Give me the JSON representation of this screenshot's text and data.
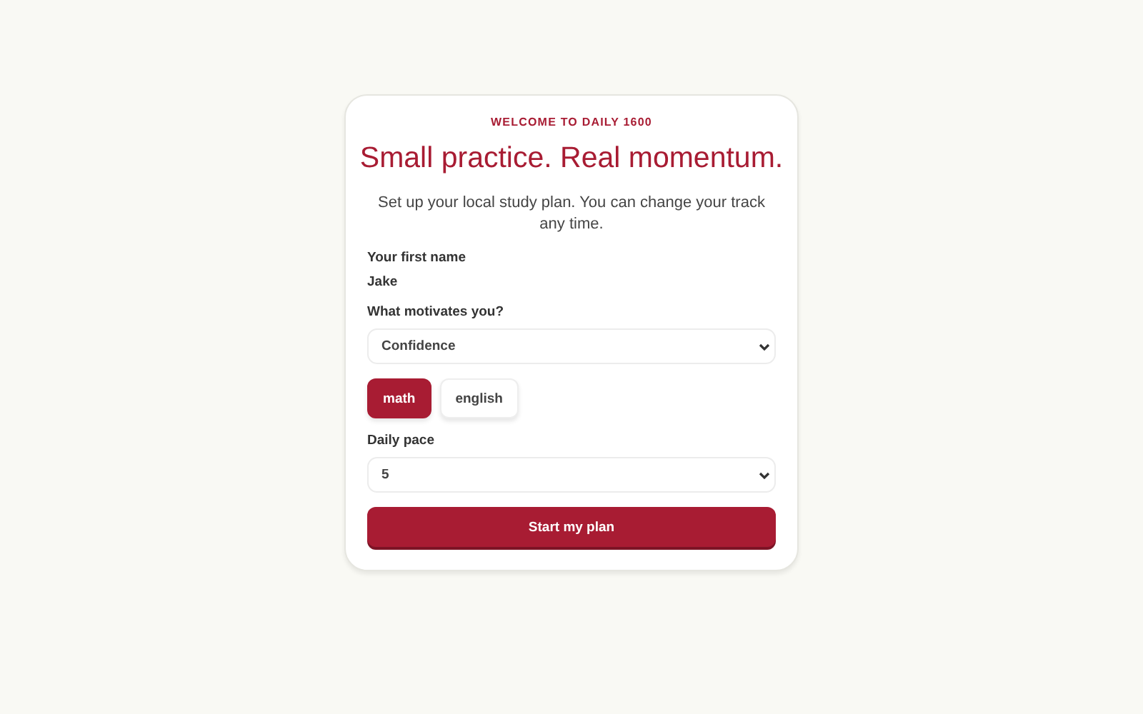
{
  "eyebrow": "WELCOME TO DAILY 1600",
  "title": "Small practice. Real momentum.",
  "subtitle": "Set up your local study plan. You can change your track any time.",
  "name_field": {
    "label": "Your first name",
    "value": "Jake"
  },
  "motivation": {
    "label": "What motivates you?",
    "value": "Confidence"
  },
  "tracks": [
    {
      "label": "math",
      "selected": true
    },
    {
      "label": "english",
      "selected": false
    }
  ],
  "pace": {
    "label": "Daily pace",
    "value": "5"
  },
  "submit": "Start my plan"
}
